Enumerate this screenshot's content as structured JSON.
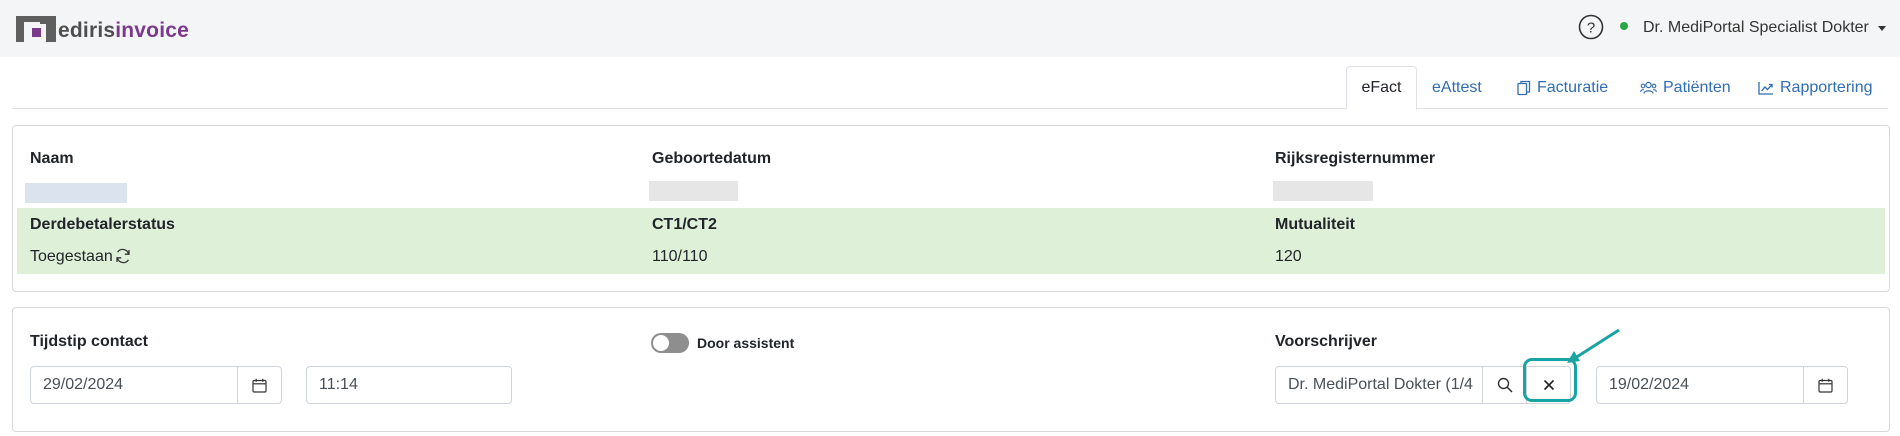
{
  "app": {
    "logo_part1": "edi ris",
    "logo_part1_display": "ediris",
    "logo_part2": "invoice"
  },
  "header": {
    "user_name": "Dr. MediPortal Specialist Dokter",
    "help_icon": "question-circle-icon",
    "status_color": "#28a745"
  },
  "tabs": [
    {
      "label": "eFact",
      "icon": ""
    },
    {
      "label": "eAttest",
      "icon": ""
    },
    {
      "label": "Facturatie",
      "icon": "copy-icon"
    },
    {
      "label": "Patiënten",
      "icon": "users-icon"
    },
    {
      "label": "Rapportering",
      "icon": "chart-line-icon"
    }
  ],
  "patient": {
    "name_label": "Naam",
    "birthdate_label": "Geboortedatum",
    "rrn_label": "Rijksregisternummer",
    "third_party_label": "Derdebetalerstatus",
    "third_party_value": "Toegestaan",
    "ct_label": "CT1/CT2",
    "ct_value": "110/110",
    "mutuality_label": "Mutualiteit",
    "mutuality_value": "120"
  },
  "contact": {
    "time_label": "Tijdstip contact",
    "date_value": "29/02/2024",
    "time_value": "11:14",
    "assistant_toggle_label": "Door assistent",
    "prescriber_label": "Voorschrijver",
    "prescriber_value": "Dr. MediPortal Dokter (1/4",
    "prescription_date": "19/02/2024"
  },
  "colors": {
    "accent": "#2f6db5",
    "brand": "#7b3a8c",
    "success_band": "#dff0d8",
    "highlight": "#1aa3a3"
  }
}
